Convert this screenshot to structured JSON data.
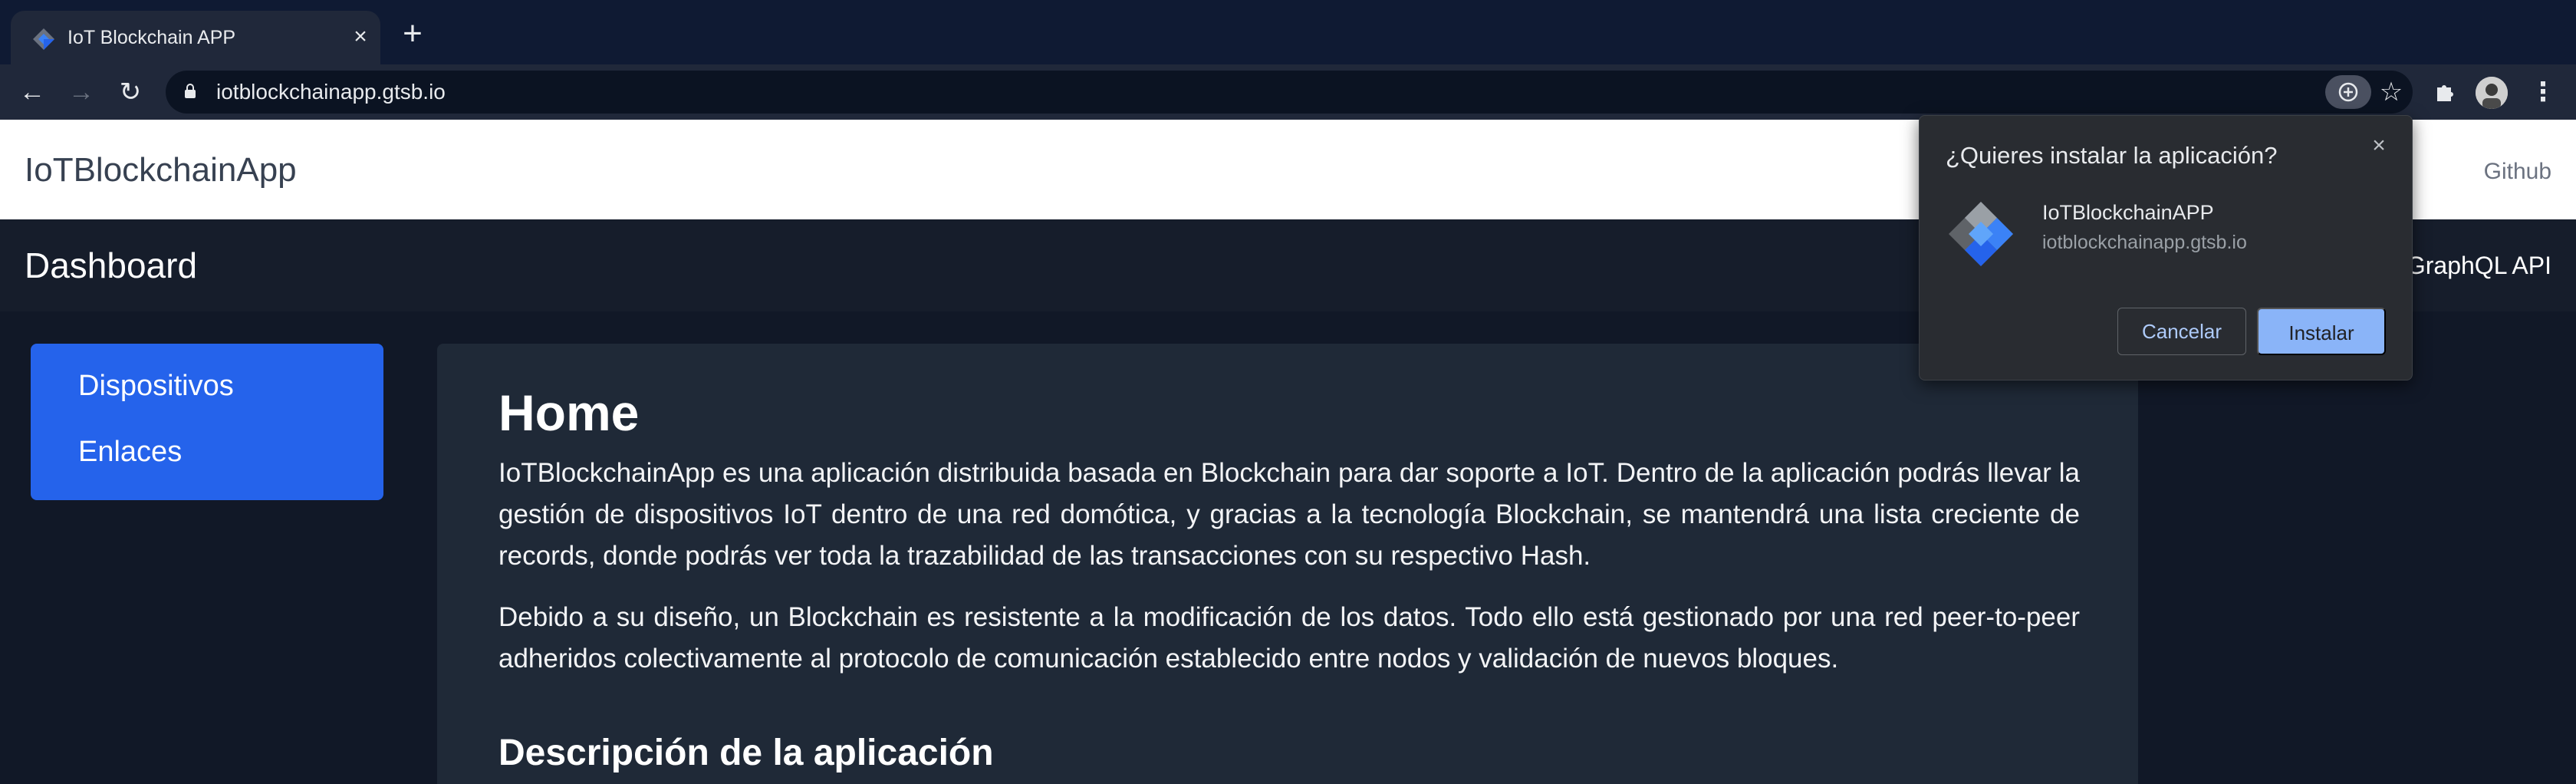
{
  "browser": {
    "tab_title": "IoT Blockchain APP",
    "url": "iotblockchainapp.gtsb.io",
    "icons": {
      "favicon": "blockchain-diamond-icon",
      "tab_close": "close-icon",
      "new_tab": "plus-icon",
      "back": "arrow-left-icon",
      "forward": "arrow-right-icon",
      "reload": "reload-icon",
      "lock": "lock-icon",
      "install": "install-app-icon",
      "bookmark": "star-icon",
      "extensions": "puzzle-icon",
      "profile": "avatar",
      "menu": "kebab-menu-icon"
    }
  },
  "site": {
    "brand": "IoTBlockchainApp",
    "github_link": "Github"
  },
  "dashboard": {
    "title": "Dashboard",
    "graphql_link": "GraphQL API"
  },
  "sidenav": {
    "items": [
      {
        "label": "Dispositivos"
      },
      {
        "label": "Enlaces"
      }
    ],
    "accent_color": "#2563eb"
  },
  "content": {
    "title": "Home",
    "paragraphs": [
      "IoTBlockchainApp es una aplicación distribuida basada en Blockchain para dar soporte a IoT. Dentro de la aplicación podrás llevar la gestión de dispositivos IoT dentro de una red domótica, y gracias a la tecnología Blockchain, se mantendrá una lista creciente de records, donde podrás ver toda la trazabilidad de las transacciones con su respectivo Hash.",
      "Debido a su diseño, un Blockchain es resistente a la modificación de los datos. Todo ello está gestionado por una red peer-to-peer adheridos colectivamente al protocolo de comunicación establecido entre nodos y validación de nuevos bloques."
    ],
    "subtitle": "Descripción de la aplicación"
  },
  "install_popup": {
    "title": "¿Quieres instalar la aplicación?",
    "app_name": "IoTBlockchainAPP",
    "app_url": "iotblockchainapp.gtsb.io",
    "cancel_label": "Cancelar",
    "install_label": "Instalar",
    "install_button_color": "#8ab4f8"
  }
}
